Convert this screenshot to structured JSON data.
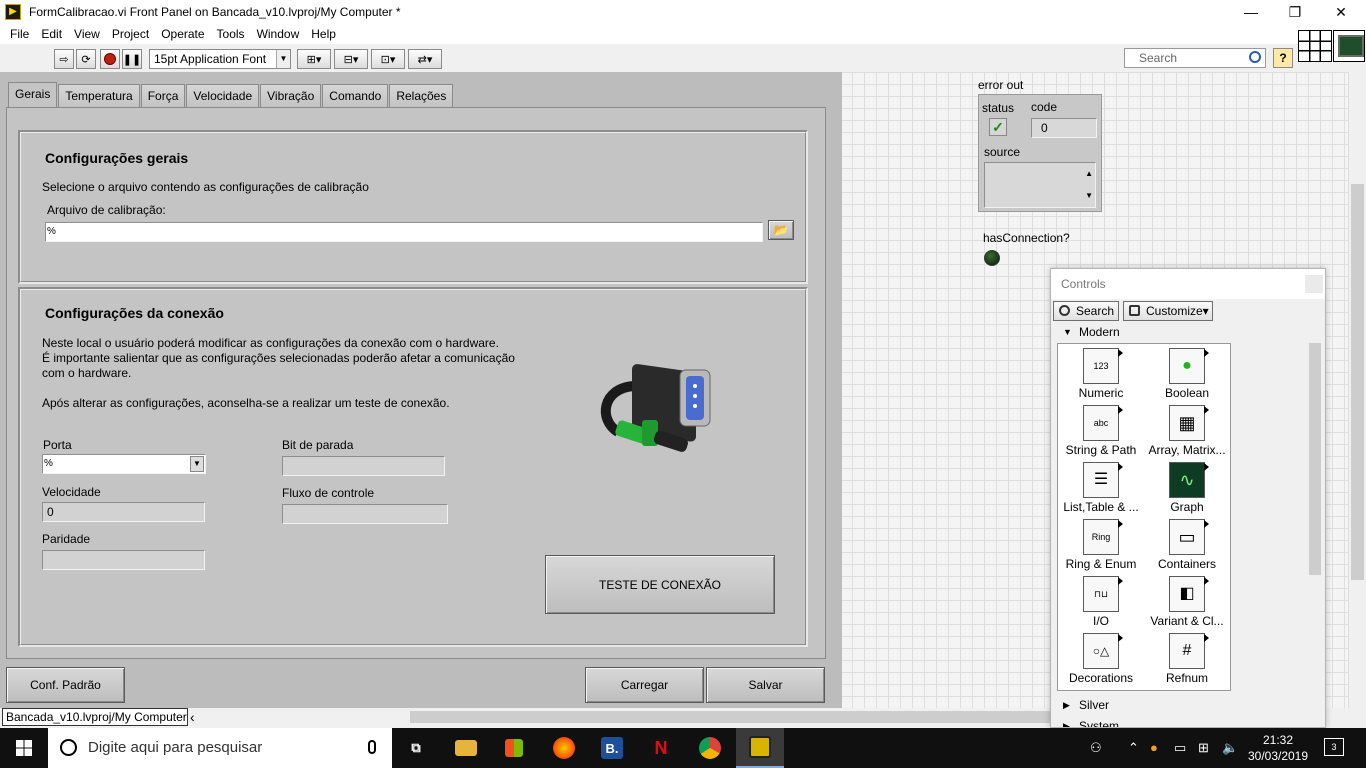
{
  "window": {
    "title": "FormCalibracao.vi Front Panel on Bancada_v10.lvproj/My Computer *",
    "minimize": "—",
    "maximize": "❐",
    "close": "✕",
    "app_icon": "labview-vi-icon"
  },
  "menu": [
    "File",
    "Edit",
    "View",
    "Project",
    "Operate",
    "Tools",
    "Window",
    "Help"
  ],
  "toolbar": {
    "font": "15pt Application Font",
    "search_placeholder": "Search",
    "help": "?",
    "buttons": [
      "run-arrow-icon",
      "run-continuously-icon",
      "abort-icon",
      "pause-icon",
      "align-icon",
      "distribute-icon",
      "resize-icon",
      "reorder-icon"
    ]
  },
  "tabs": [
    "Gerais",
    "Temperatura",
    "Força",
    "Velocidade",
    "Vibração",
    "Comando",
    "Relações"
  ],
  "active_tab": "Gerais",
  "gerais": {
    "title": "Configurações gerais",
    "description": "Selecione o arquivo contendo as configurações de calibração",
    "file_label": "Arquivo de calibração:",
    "file_value": ""
  },
  "conexao": {
    "title": "Configurações da conexão",
    "desc_lines": [
      "Neste local o usuário poderá modificar as configurações da conexão com o hardware.",
      "É importante salientar que as configurações selecionadas poderão afetar a comunicação",
      "com o hardware."
    ],
    "advice": "Após alterar as configurações, aconselha-se a realizar um teste de conexão.",
    "porta_label": "Porta",
    "porta_value": "",
    "velocidade_label": "Velocidade",
    "velocidade_value": "0",
    "paridade_label": "Paridade",
    "paridade_value": "",
    "bit_parada_label": "Bit de parada",
    "bit_parada_value": "",
    "fluxo_label": "Fluxo de controle",
    "fluxo_value": "",
    "test_button": "TESTE DE CONEXÃO"
  },
  "bottom_buttons": {
    "default": "Conf. Padrão",
    "load": "Carregar",
    "save": "Salvar"
  },
  "error_out": {
    "label": "error out",
    "status_label": "status",
    "code_label": "code",
    "code_value": "0",
    "source_label": "source",
    "status_mark": "✓"
  },
  "has_connection": {
    "label": "hasConnection?"
  },
  "statusbar": {
    "project": "Bancada_v10.lvproj/My Computer",
    "arrow": "‹"
  },
  "palette": {
    "title": "Controls",
    "search": "Search",
    "customize": "Customize▾",
    "categories": [
      "Modern",
      "Silver",
      "System"
    ],
    "items": [
      {
        "label": "Numeric",
        "icon": "numeric-icon",
        "glyph": "123"
      },
      {
        "label": "Boolean",
        "icon": "boolean-icon",
        "glyph": "●"
      },
      {
        "label": "String & Path",
        "icon": "string-path-icon",
        "glyph": "abc"
      },
      {
        "label": "Array, Matrix...",
        "icon": "array-matrix-icon",
        "glyph": "▦"
      },
      {
        "label": "List,Table & ...",
        "icon": "list-table-icon",
        "glyph": "☰"
      },
      {
        "label": "Graph",
        "icon": "graph-icon",
        "glyph": "∿"
      },
      {
        "label": "Ring & Enum",
        "icon": "ring-enum-icon",
        "glyph": "Ring"
      },
      {
        "label": "Containers",
        "icon": "containers-icon",
        "glyph": "▭"
      },
      {
        "label": "I/O",
        "icon": "io-icon",
        "glyph": "⊓⊔"
      },
      {
        "label": "Variant & Cl...",
        "icon": "variant-class-icon",
        "glyph": "◧"
      },
      {
        "label": "Decorations",
        "icon": "decorations-icon",
        "glyph": "○△"
      },
      {
        "label": "Refnum",
        "icon": "refnum-icon",
        "glyph": "#"
      }
    ]
  },
  "taskbar": {
    "search_placeholder": "Digite aqui para pesquisar",
    "apps": [
      {
        "name": "task-view-icon",
        "glyph": "⧉",
        "color": "#101010"
      },
      {
        "name": "file-explorer-icon",
        "glyph": "",
        "color": "#e8b33a"
      },
      {
        "name": "store-icon",
        "glyph": "",
        "color": "#101010"
      },
      {
        "name": "firefox-icon",
        "glyph": "",
        "color": "#ff7b00"
      },
      {
        "name": "bizagi-icon",
        "glyph": "B.",
        "color": "#1e4f99"
      },
      {
        "name": "netflix-icon",
        "glyph": "N",
        "color": "#111111"
      },
      {
        "name": "chrome-icon",
        "glyph": "",
        "color": "#2e9d48"
      },
      {
        "name": "labview-icon",
        "glyph": "",
        "color": "#d8b400"
      }
    ],
    "time": "21:32",
    "date": "30/03/2019",
    "notifications": "3"
  }
}
